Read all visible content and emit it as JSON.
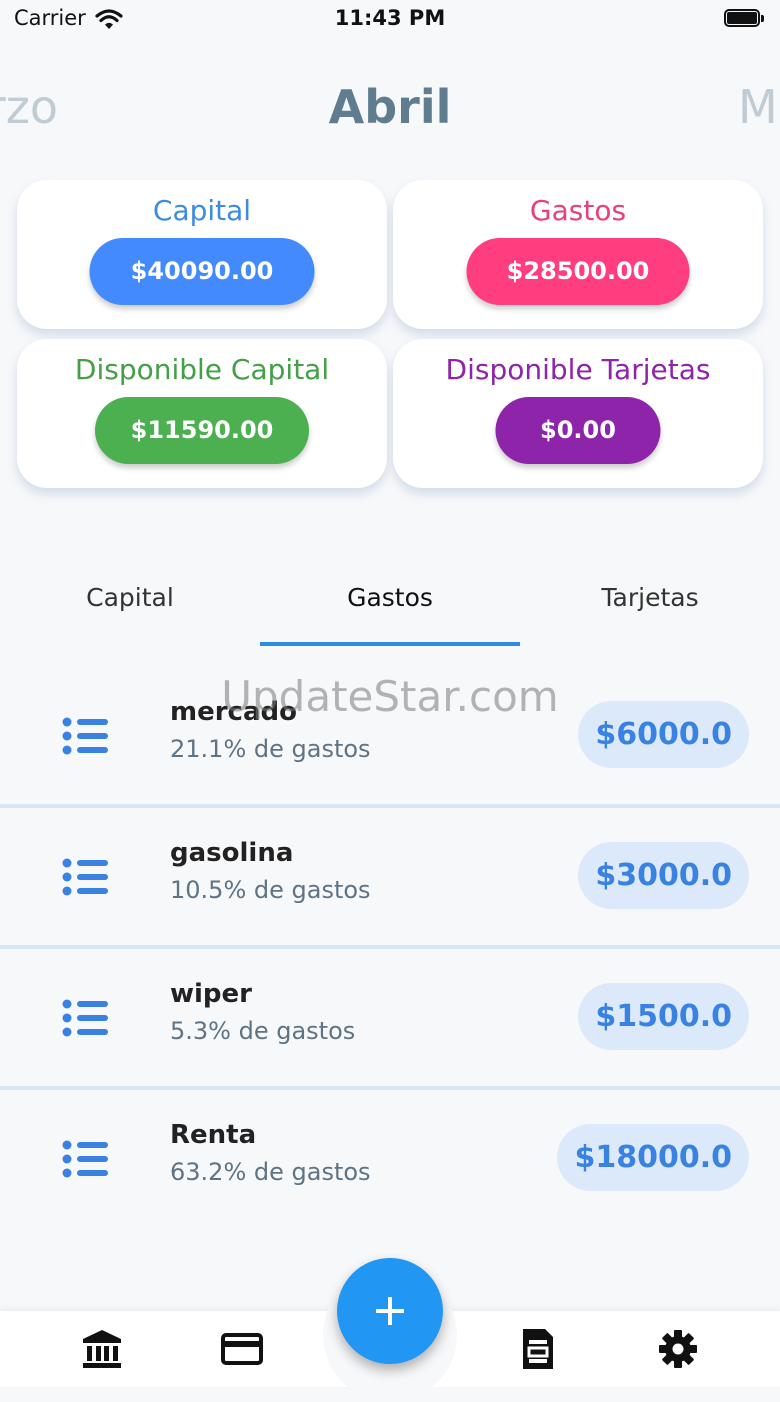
{
  "status_bar": {
    "carrier": "Carrier",
    "time": "11:43 PM"
  },
  "months": {
    "prev": "rzo",
    "current": "Abril",
    "next": "M"
  },
  "summary": {
    "capital": {
      "title": "Capital",
      "value": "$40090.00",
      "title_color": "#3d8be0",
      "pill_color": "#448aff"
    },
    "gastos": {
      "title": "Gastos",
      "value": "$28500.00",
      "title_color": "#e8407a",
      "pill_color": "#ff3d7f"
    },
    "disponible_capital": {
      "title": "Disponible Capital",
      "value": "$11590.00",
      "title_color": "#43a047",
      "pill_color": "#4caf50"
    },
    "disponible_tarjetas": {
      "title": "Disponible Tarjetas",
      "value": "$0.00",
      "title_color": "#8e24aa",
      "pill_color": "#8e24aa"
    }
  },
  "tabs": [
    {
      "label": "Capital",
      "active": false
    },
    {
      "label": "Gastos",
      "active": true
    },
    {
      "label": "Tarjetas",
      "active": false
    }
  ],
  "watermark": "UpdateStar.com",
  "expenses": [
    {
      "name": "mercado",
      "percent": "21.1% de gastos",
      "amount": "$6000.0"
    },
    {
      "name": "gasolina",
      "percent": "10.5% de gastos",
      "amount": "$3000.0"
    },
    {
      "name": "wiper",
      "percent": "5.3% de gastos",
      "amount": "$1500.0"
    },
    {
      "name": "Renta",
      "percent": "63.2% de gastos",
      "amount": "$18000.0"
    }
  ],
  "bottom_nav": {
    "items": [
      {
        "icon": "bank-icon"
      },
      {
        "icon": "credit-card-icon"
      },
      {
        "icon": "document-icon"
      },
      {
        "icon": "gear-icon"
      }
    ],
    "fab_icon": "plus-icon",
    "accent": "#2196f3"
  }
}
